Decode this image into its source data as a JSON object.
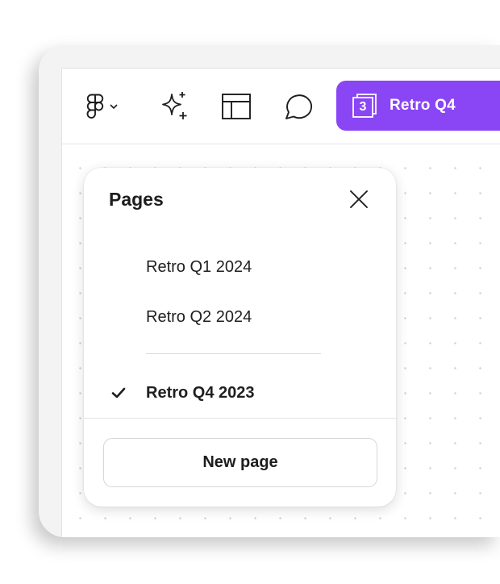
{
  "toolbar": {
    "menu_icon": "figma-logo-icon",
    "menu_chevron_icon": "chevron-down-icon",
    "ai_icon": "sparkles-icon",
    "layout_icon": "layout-icon",
    "comment_icon": "comment-icon",
    "page_count": "3",
    "current_page_label": "Retro Q4",
    "accent_color": "#8a45f5"
  },
  "pages_panel": {
    "title": "Pages",
    "close_icon": "close-icon",
    "pages": [
      {
        "label": "Retro Q1 2024",
        "active": false
      },
      {
        "label": "Retro Q2 2024",
        "active": false
      },
      {
        "label": "Retro Q4 2023",
        "active": true
      }
    ],
    "check_icon": "checkmark-icon",
    "new_page_label": "New page"
  }
}
